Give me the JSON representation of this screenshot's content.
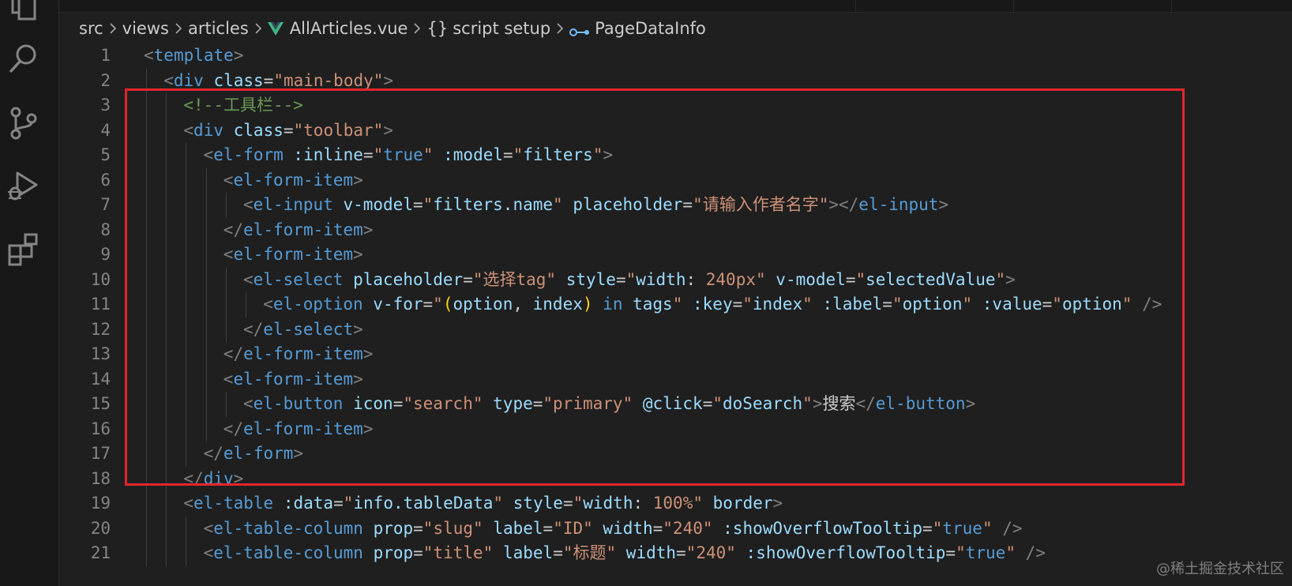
{
  "activity_bar": {
    "icons": [
      "explorer-icon",
      "search-icon",
      "source-control-icon",
      "run-debug-icon",
      "extensions-icon"
    ]
  },
  "breadcrumb": [
    "src",
    "views",
    "articles",
    "AllArticles.vue",
    "script setup",
    "PageDataInfo"
  ],
  "colors": {
    "background": "#1f1f1f",
    "tag": "#569cd6",
    "attribute": "#9cdcfe",
    "string": "#ce9178",
    "comment": "#6a9955",
    "highlight_border": "#e3262e"
  },
  "code_lines": [
    {
      "n": "1",
      "tokens": [
        [
          "<",
          "p"
        ],
        [
          "template",
          "t"
        ],
        [
          ">",
          "p"
        ]
      ]
    },
    {
      "n": "2",
      "tokens": [
        [
          "<",
          "p"
        ],
        [
          "div",
          "t"
        ],
        [
          " ",
          "x"
        ],
        [
          "class",
          "a"
        ],
        [
          "=",
          "e"
        ],
        [
          "\"main-body\"",
          "s"
        ],
        [
          ">",
          "p"
        ]
      ]
    },
    {
      "n": "3",
      "tokens": [
        [
          "<!--工具栏-->",
          "c"
        ]
      ]
    },
    {
      "n": "4",
      "tokens": [
        [
          "<",
          "p"
        ],
        [
          "div",
          "t"
        ],
        [
          " ",
          "x"
        ],
        [
          "class",
          "a"
        ],
        [
          "=",
          "e"
        ],
        [
          "\"toolbar\"",
          "s"
        ],
        [
          ">",
          "p"
        ]
      ]
    },
    {
      "n": "5",
      "tokens": [
        [
          "<",
          "p"
        ],
        [
          "el-form",
          "t"
        ],
        [
          " ",
          "x"
        ],
        [
          ":inline",
          "a"
        ],
        [
          "=",
          "e"
        ],
        [
          "\"",
          "s"
        ],
        [
          "true",
          "k"
        ],
        [
          "\"",
          "s"
        ],
        [
          " ",
          "x"
        ],
        [
          ":model",
          "a"
        ],
        [
          "=",
          "e"
        ],
        [
          "\"",
          "s"
        ],
        [
          "filters",
          "m"
        ],
        [
          "\"",
          "s"
        ],
        [
          ">",
          "p"
        ]
      ]
    },
    {
      "n": "6",
      "tokens": [
        [
          "<",
          "p"
        ],
        [
          "el-form-item",
          "t"
        ],
        [
          ">",
          "p"
        ]
      ]
    },
    {
      "n": "7",
      "tokens": [
        [
          "<",
          "p"
        ],
        [
          "el-input",
          "t"
        ],
        [
          " ",
          "x"
        ],
        [
          "v-model",
          "a"
        ],
        [
          "=",
          "e"
        ],
        [
          "\"",
          "s"
        ],
        [
          "filters.name",
          "m"
        ],
        [
          "\"",
          "s"
        ],
        [
          " ",
          "x"
        ],
        [
          "placeholder",
          "a"
        ],
        [
          "=",
          "e"
        ],
        [
          "\"请输入作者名字\"",
          "s"
        ],
        [
          "></",
          "p"
        ],
        [
          "el-input",
          "t"
        ],
        [
          ">",
          "p"
        ]
      ]
    },
    {
      "n": "8",
      "tokens": [
        [
          "</",
          "p"
        ],
        [
          "el-form-item",
          "t"
        ],
        [
          ">",
          "p"
        ]
      ]
    },
    {
      "n": "9",
      "tokens": [
        [
          "<",
          "p"
        ],
        [
          "el-form-item",
          "t"
        ],
        [
          ">",
          "p"
        ]
      ]
    },
    {
      "n": "10",
      "tokens": [
        [
          "<",
          "p"
        ],
        [
          "el-select",
          "t"
        ],
        [
          " ",
          "x"
        ],
        [
          "placeholder",
          "a"
        ],
        [
          "=",
          "e"
        ],
        [
          "\"选择tag\"",
          "s"
        ],
        [
          " ",
          "x"
        ],
        [
          "style",
          "a"
        ],
        [
          "=",
          "e"
        ],
        [
          "\"",
          "s"
        ],
        [
          "width",
          "m"
        ],
        [
          ": ",
          "x"
        ],
        [
          "240px",
          "s"
        ],
        [
          "\"",
          "s"
        ],
        [
          " ",
          "x"
        ],
        [
          "v-model",
          "a"
        ],
        [
          "=",
          "e"
        ],
        [
          "\"",
          "s"
        ],
        [
          "selectedValue",
          "m"
        ],
        [
          "\"",
          "s"
        ],
        [
          ">",
          "p"
        ]
      ]
    },
    {
      "n": "11",
      "tokens": [
        [
          "<",
          "p"
        ],
        [
          "el-option",
          "t"
        ],
        [
          " ",
          "x"
        ],
        [
          "v-for",
          "a"
        ],
        [
          "=",
          "e"
        ],
        [
          "\"",
          "s"
        ],
        [
          "(",
          "b"
        ],
        [
          "option",
          "m"
        ],
        [
          ", ",
          "x"
        ],
        [
          "index",
          "m"
        ],
        [
          ")",
          "b"
        ],
        [
          " ",
          "x"
        ],
        [
          "in",
          "k"
        ],
        [
          " ",
          "x"
        ],
        [
          "tags",
          "m"
        ],
        [
          "\"",
          "s"
        ],
        [
          " ",
          "x"
        ],
        [
          ":key",
          "a"
        ],
        [
          "=",
          "e"
        ],
        [
          "\"",
          "s"
        ],
        [
          "index",
          "m"
        ],
        [
          "\"",
          "s"
        ],
        [
          " ",
          "x"
        ],
        [
          ":label",
          "a"
        ],
        [
          "=",
          "e"
        ],
        [
          "\"",
          "s"
        ],
        [
          "option",
          "m"
        ],
        [
          "\"",
          "s"
        ],
        [
          " ",
          "x"
        ],
        [
          ":value",
          "a"
        ],
        [
          "=",
          "e"
        ],
        [
          "\"",
          "s"
        ],
        [
          "option",
          "m"
        ],
        [
          "\"",
          "s"
        ],
        [
          " />",
          "p"
        ]
      ]
    },
    {
      "n": "12",
      "tokens": [
        [
          "</",
          "p"
        ],
        [
          "el-select",
          "t"
        ],
        [
          ">",
          "p"
        ]
      ]
    },
    {
      "n": "13",
      "tokens": [
        [
          "</",
          "p"
        ],
        [
          "el-form-item",
          "t"
        ],
        [
          ">",
          "p"
        ]
      ]
    },
    {
      "n": "14",
      "tokens": [
        [
          "<",
          "p"
        ],
        [
          "el-form-item",
          "t"
        ],
        [
          ">",
          "p"
        ]
      ]
    },
    {
      "n": "15",
      "tokens": [
        [
          "<",
          "p"
        ],
        [
          "el-button",
          "t"
        ],
        [
          " ",
          "x"
        ],
        [
          "icon",
          "a"
        ],
        [
          "=",
          "e"
        ],
        [
          "\"search\"",
          "s"
        ],
        [
          " ",
          "x"
        ],
        [
          "type",
          "a"
        ],
        [
          "=",
          "e"
        ],
        [
          "\"primary\"",
          "s"
        ],
        [
          " ",
          "x"
        ],
        [
          "@click",
          "a"
        ],
        [
          "=",
          "e"
        ],
        [
          "\"",
          "s"
        ],
        [
          "doSearch",
          "m"
        ],
        [
          "\"",
          "s"
        ],
        [
          ">",
          "p"
        ],
        [
          "搜索",
          "x"
        ],
        [
          "</",
          "p"
        ],
        [
          "el-button",
          "t"
        ],
        [
          ">",
          "p"
        ]
      ]
    },
    {
      "n": "16",
      "tokens": [
        [
          "</",
          "p"
        ],
        [
          "el-form-item",
          "t"
        ],
        [
          ">",
          "p"
        ]
      ]
    },
    {
      "n": "17",
      "tokens": [
        [
          "</",
          "p"
        ],
        [
          "el-form",
          "t"
        ],
        [
          ">",
          "p"
        ]
      ]
    },
    {
      "n": "18",
      "tokens": [
        [
          "</",
          "p"
        ],
        [
          "div",
          "t"
        ],
        [
          ">",
          "p"
        ]
      ]
    },
    {
      "n": "19",
      "tokens": [
        [
          "<",
          "p"
        ],
        [
          "el-table",
          "t"
        ],
        [
          " ",
          "x"
        ],
        [
          ":data",
          "a"
        ],
        [
          "=",
          "e"
        ],
        [
          "\"",
          "s"
        ],
        [
          "info.tableData",
          "m"
        ],
        [
          "\"",
          "s"
        ],
        [
          " ",
          "x"
        ],
        [
          "style",
          "a"
        ],
        [
          "=",
          "e"
        ],
        [
          "\"",
          "s"
        ],
        [
          "width",
          "m"
        ],
        [
          ": ",
          "x"
        ],
        [
          "100%",
          "s"
        ],
        [
          "\"",
          "s"
        ],
        [
          " ",
          "x"
        ],
        [
          "border",
          "a"
        ],
        [
          ">",
          "p"
        ]
      ]
    },
    {
      "n": "20",
      "tokens": [
        [
          "<",
          "p"
        ],
        [
          "el-table-column",
          "t"
        ],
        [
          " ",
          "x"
        ],
        [
          "prop",
          "a"
        ],
        [
          "=",
          "e"
        ],
        [
          "\"slug\"",
          "s"
        ],
        [
          " ",
          "x"
        ],
        [
          "label",
          "a"
        ],
        [
          "=",
          "e"
        ],
        [
          "\"ID\"",
          "s"
        ],
        [
          " ",
          "x"
        ],
        [
          "width",
          "a"
        ],
        [
          "=",
          "e"
        ],
        [
          "\"240\"",
          "s"
        ],
        [
          " ",
          "x"
        ],
        [
          ":showOverflowTooltip",
          "a"
        ],
        [
          "=",
          "e"
        ],
        [
          "\"",
          "s"
        ],
        [
          "true",
          "k"
        ],
        [
          "\"",
          "s"
        ],
        [
          " />",
          "p"
        ]
      ]
    },
    {
      "n": "21",
      "tokens": [
        [
          "<",
          "p"
        ],
        [
          "el-table-column",
          "t"
        ],
        [
          " ",
          "x"
        ],
        [
          "prop",
          "a"
        ],
        [
          "=",
          "e"
        ],
        [
          "\"title\"",
          "s"
        ],
        [
          " ",
          "x"
        ],
        [
          "label",
          "a"
        ],
        [
          "=",
          "e"
        ],
        [
          "\"标题\"",
          "s"
        ],
        [
          " ",
          "x"
        ],
        [
          "width",
          "a"
        ],
        [
          "=",
          "e"
        ],
        [
          "\"240\"",
          "s"
        ],
        [
          " ",
          "x"
        ],
        [
          ":showOverflowTooltip",
          "a"
        ],
        [
          "=",
          "e"
        ],
        [
          "\"",
          "s"
        ],
        [
          "true",
          "k"
        ],
        [
          "\"",
          "s"
        ],
        [
          " />",
          "p"
        ]
      ]
    }
  ],
  "watermark": "@稀土掘金技术社区"
}
